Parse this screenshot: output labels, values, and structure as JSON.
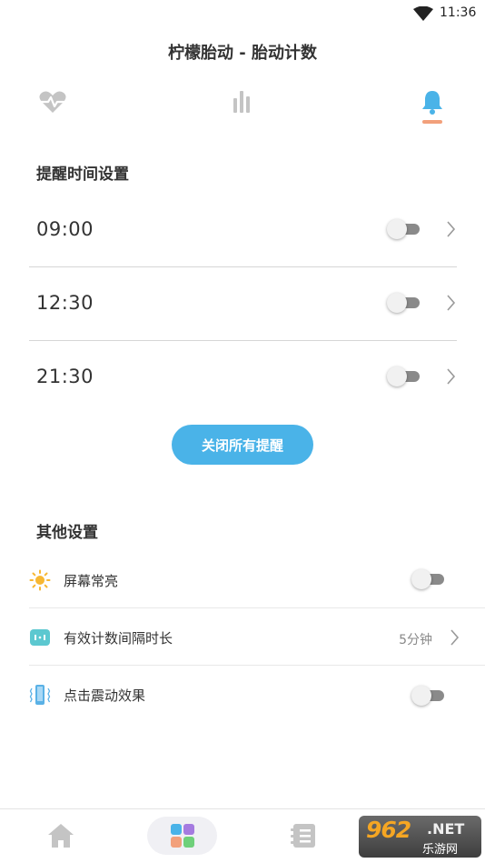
{
  "status_bar": {
    "time": "11:36"
  },
  "header": {
    "title": "柠檬胎动 - 胎动计数"
  },
  "tabs": [
    {
      "icon": "heartbeat-icon",
      "active": false
    },
    {
      "icon": "bar-chart-icon",
      "active": false
    },
    {
      "icon": "bell-icon",
      "active": true
    }
  ],
  "reminders": {
    "section_title": "提醒时间设置",
    "items": [
      {
        "time": "09:00",
        "enabled": false
      },
      {
        "time": "12:30",
        "enabled": false
      },
      {
        "time": "21:30",
        "enabled": false
      }
    ],
    "close_all_label": "关闭所有提醒"
  },
  "other_settings": {
    "section_title": "其他设置",
    "items": [
      {
        "label": "屏幕常亮",
        "icon": "sun-icon",
        "enabled": false
      },
      {
        "label": "有效计数间隔时长",
        "icon": "interval-icon",
        "value": "5分钟"
      },
      {
        "label": "点击震动效果",
        "icon": "vibration-icon",
        "enabled": false
      }
    ]
  },
  "bottom_nav": [
    {
      "icon": "home-icon",
      "active": false
    },
    {
      "icon": "grid-apps-icon",
      "active": true
    },
    {
      "icon": "list-icon",
      "active": false
    }
  ],
  "watermark": {
    "number": "962",
    "suffix": ".NET",
    "sub": "乐游网"
  },
  "colors": {
    "accent": "#4ab3e8",
    "tab_indicator": "#f2a07b",
    "icon_gray": "#c4c4c4"
  }
}
